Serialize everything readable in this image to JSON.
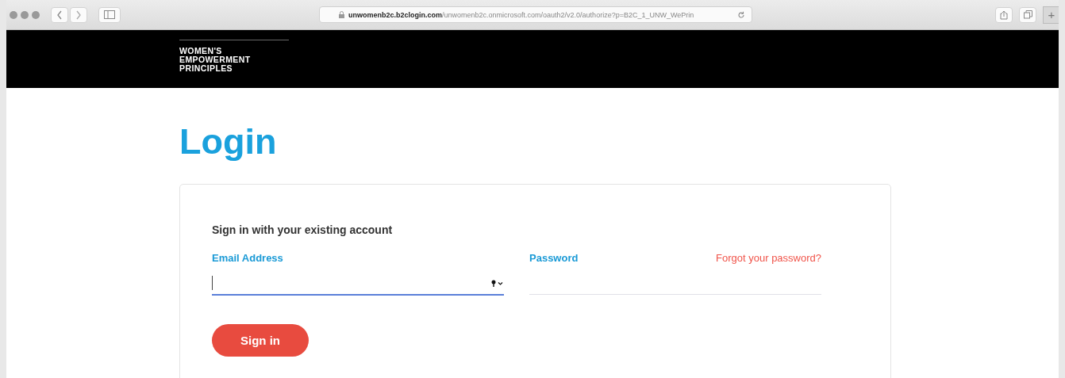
{
  "browser": {
    "url": "**unwomenb2c.b2clogin.com**/unwomenb2c.onmicrosoft.com/oauth2/v2.0/authorize?p=B2C_1_UNW_WePrin",
    "new_tab": "+"
  },
  "header": {
    "logo_lines": [
      "WOMEN'S",
      "EMPOWERMENT",
      "PRINCIPLES"
    ]
  },
  "page": {
    "title": "Login"
  },
  "form": {
    "heading": "Sign in with your existing account",
    "fields": [
      {
        "kind": "email",
        "label": "Email Address",
        "focused": true
      },
      {
        "kind": "password",
        "label": "Password",
        "focused": false,
        "link": "Forgot your password?"
      }
    ],
    "submit": "Sign in"
  }
}
